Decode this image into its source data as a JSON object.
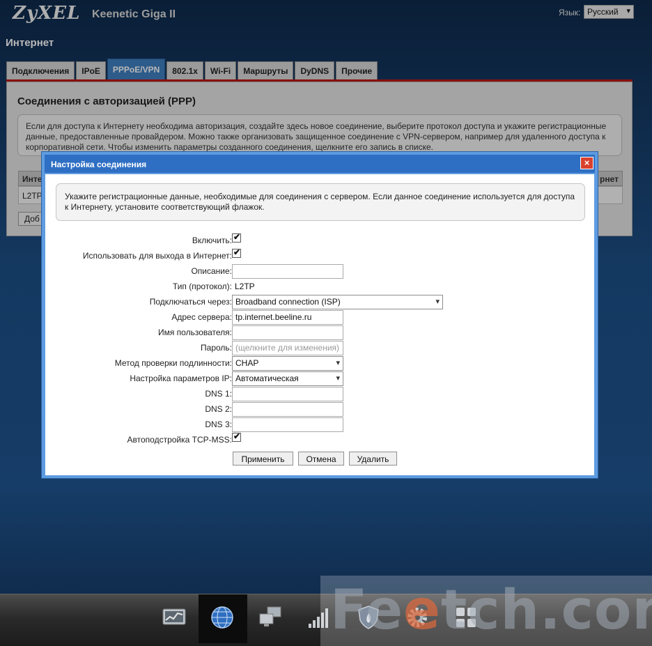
{
  "header": {
    "logo": "ZyXEL",
    "model": "Keenetic Giga II",
    "lang_label": "Язык:",
    "lang_value": "Русский"
  },
  "section_title": "Интернет",
  "tabs": [
    {
      "label": "Подключения"
    },
    {
      "label": "IPoE"
    },
    {
      "label": "PPPoE/VPN"
    },
    {
      "label": "802.1x"
    },
    {
      "label": "Wi-Fi"
    },
    {
      "label": "Маршруты"
    },
    {
      "label": "DyDNS"
    },
    {
      "label": "Прочие"
    }
  ],
  "panel": {
    "title": "Соединения с авторизацией (PPP)",
    "info": "Если для доступа к Интернету необходима авторизация, создайте здесь новое соединение, выберите протокол доступа и укажите регистрационные данные, предоставленные провайдером. Можно также организовать защищенное соединение с VPN-сервером, например для удаленного доступа к корпоративной сети. Чтобы изменить параметры созданного соединения, щелкните его запись в списке.",
    "table_head_left": "Инте",
    "table_head_right": "рнет",
    "table_row": "L2TP",
    "add_button": "Доб"
  },
  "dialog": {
    "title": "Настройка соединения",
    "close": "×",
    "info": "Укажите регистрационные данные, необходимые для соединения с сервером. Если данное соединение используется для доступа к Интернету, установите соответствующий флажок.",
    "fields": {
      "enable": {
        "label": "Включить:",
        "checked": true
      },
      "internet": {
        "label": "Использовать для выхода в Интернет:",
        "checked": true
      },
      "description": {
        "label": "Описание:",
        "value": ""
      },
      "type": {
        "label": "Тип (протокол):",
        "value": "L2TP"
      },
      "connect_via": {
        "label": "Подключаться через:",
        "value": "Broadband connection (ISP)"
      },
      "server": {
        "label": "Адрес сервера:",
        "value": "tp.internet.beeline.ru"
      },
      "username": {
        "label": "Имя пользователя:",
        "value": ""
      },
      "password": {
        "label": "Пароль:",
        "placeholder": "(щелкните для изменения)"
      },
      "auth": {
        "label": "Метод проверки подлинности:",
        "value": "CHAP"
      },
      "ip_settings": {
        "label": "Настройка параметров IP:",
        "value": "Автоматическая"
      },
      "dns1": {
        "label": "DNS 1:",
        "value": ""
      },
      "dns2": {
        "label": "DNS 2:",
        "value": ""
      },
      "dns3": {
        "label": "DNS 3:",
        "value": ""
      },
      "tcp_mss": {
        "label": "Автоподстройка TCP-MSS:",
        "checked": true
      }
    },
    "buttons": {
      "apply": "Применить",
      "cancel": "Отмена",
      "delete": "Удалить"
    }
  },
  "bottom_nav": [
    {
      "icon": "chart-monitor-icon"
    },
    {
      "icon": "globe-icon"
    },
    {
      "icon": "network-computers-icon"
    },
    {
      "icon": "signal-bars-icon"
    },
    {
      "icon": "shield-icon"
    },
    {
      "icon": "gear-icon"
    },
    {
      "icon": "apps-grid-icon"
    }
  ],
  "watermark": {
    "pre": "Fe",
    "o": "e",
    "post": "tch.com"
  }
}
